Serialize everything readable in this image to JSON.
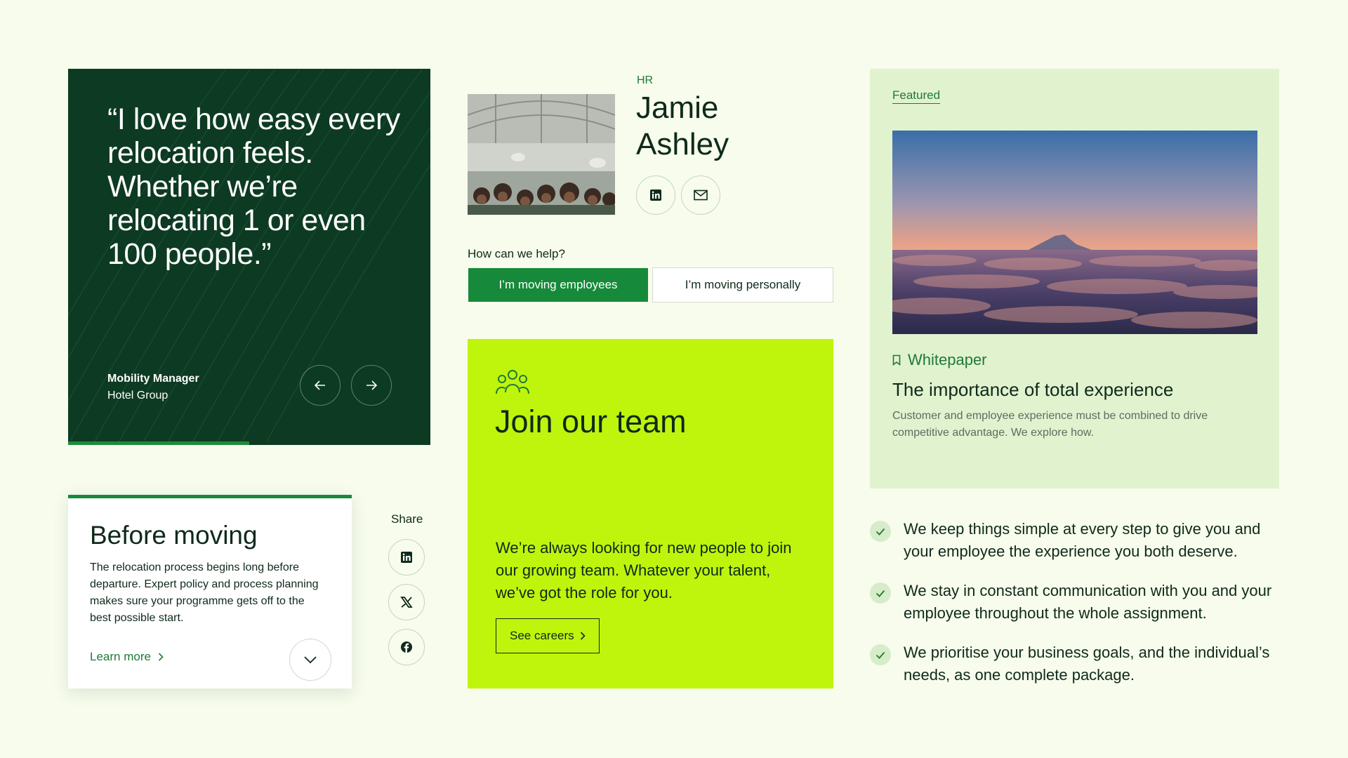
{
  "testimonial": {
    "quote": "“I love how easy every relocation feels. Whether we’re relocating 1 or even 100 people.”",
    "role": "Mobility Manager",
    "company": "Hotel Group",
    "progress": 0.5
  },
  "profile": {
    "tag": "HR",
    "first_name": "Jamie",
    "last_name": "Ashley",
    "linkedin_icon": "linkedin-icon",
    "email_icon": "email-icon"
  },
  "help": {
    "label": "How can we help?",
    "primary": "I’m moving employees",
    "secondary": "I’m moving personally"
  },
  "join": {
    "icon": "people-icon",
    "title": "Join our team",
    "text": "We’re always looking for new people to join our growing team. Whatever your talent, we’ve got the role for you.",
    "button": "See careers"
  },
  "before": {
    "title": "Before moving",
    "text": "The relocation process begins long before departure. Expert policy and process planning makes sure your programme gets off to the best possible start.",
    "link": "Learn more"
  },
  "share": {
    "label": "Share",
    "icons": [
      "linkedin-icon",
      "x-icon",
      "facebook-icon"
    ]
  },
  "featured": {
    "label": "Featured",
    "type": "Whitepaper",
    "title": "The importance of total experience",
    "desc": "Customer and employee experience must be combined to drive competitive advantage. We explore how."
  },
  "benefits": [
    "We keep things simple at every step to give you and your employee the experience you both deserve.",
    "We stay in constant communication with you and your employee throughout the whole assignment.",
    "We prioritise your business goals, and the individual’s needs, as one complete package."
  ],
  "colors": {
    "background": "#f7fcec",
    "dark_green": "#0d3a22",
    "primary_green": "#168a3a",
    "lime": "#bff40d",
    "featured_bg": "#e1f2cf"
  }
}
